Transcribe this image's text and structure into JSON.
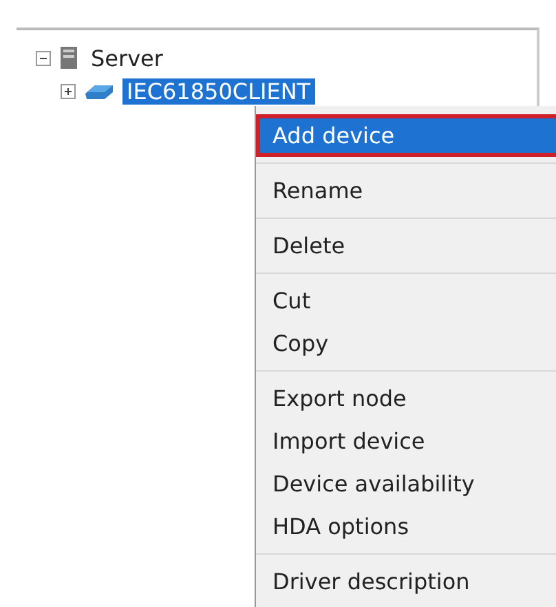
{
  "tree": [
    {
      "label": "Server",
      "kind": "server",
      "expanded": true,
      "selected": false,
      "children": [
        {
          "label": "IEC61850CLIENT",
          "kind": "device",
          "expanded": false,
          "selected": true
        }
      ]
    }
  ],
  "context_menu": {
    "groups": [
      [
        {
          "label": "Add device",
          "selected": true
        }
      ],
      [
        {
          "label": "Rename",
          "selected": false
        }
      ],
      [
        {
          "label": "Delete",
          "selected": false
        }
      ],
      [
        {
          "label": "Cut",
          "selected": false
        },
        {
          "label": "Copy",
          "selected": false
        }
      ],
      [
        {
          "label": "Export node",
          "selected": false
        },
        {
          "label": "Import device",
          "selected": false
        },
        {
          "label": "Device availability",
          "selected": false
        },
        {
          "label": "HDA options",
          "selected": false
        }
      ],
      [
        {
          "label": "Driver description",
          "selected": false
        }
      ]
    ]
  }
}
